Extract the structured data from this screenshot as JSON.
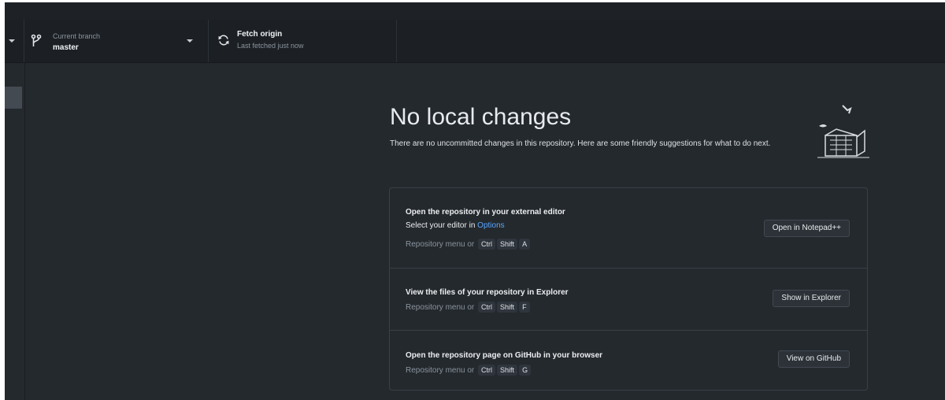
{
  "toolbar": {
    "branch_label": "Current branch",
    "branch_name": "master",
    "fetch_title": "Fetch origin",
    "fetch_status": "Last fetched just now"
  },
  "main": {
    "heading": "No local changes",
    "description": "There are no uncommitted changes in this repository. Here are some friendly suggestions for what to do next."
  },
  "suggestions": {
    "editor": {
      "title": "Open the repository in your external editor",
      "select_prefix": "Select your editor in",
      "options_link": "Options",
      "hint": "Repository menu or",
      "keys": [
        "Ctrl",
        "Shift",
        "A"
      ],
      "button": "Open in Notepad++"
    },
    "explorer": {
      "title": "View the files of your repository in Explorer",
      "hint": "Repository menu or",
      "keys": [
        "Ctrl",
        "Shift",
        "F"
      ],
      "button": "Show in Explorer"
    },
    "github": {
      "title": "Open the repository page on GitHub in your browser",
      "hint": "Repository menu or",
      "keys": [
        "Ctrl",
        "Shift",
        "G"
      ],
      "button": "View on GitHub"
    }
  },
  "colors": {
    "background": "#24292e",
    "toolbar": "#1c2025",
    "link": "#58a6ff"
  },
  "icons": {
    "branch": "git-branch-icon",
    "fetch": "sync-icon",
    "dropdown": "triangle-down-icon"
  }
}
